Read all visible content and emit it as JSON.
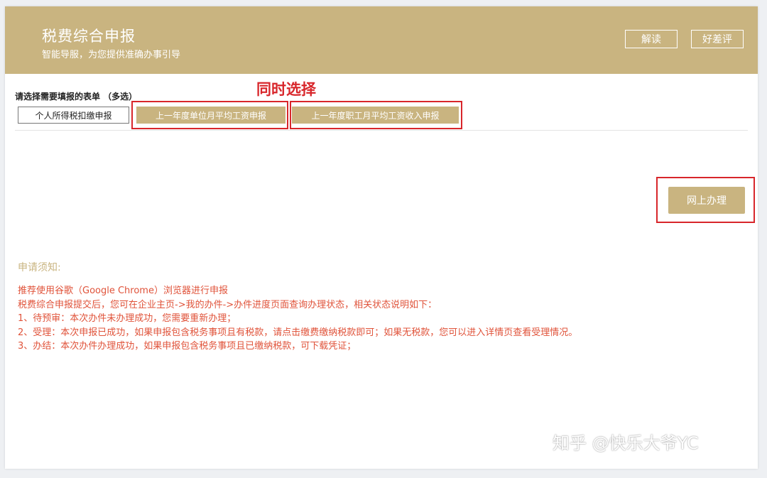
{
  "header": {
    "title": "税费综合申报",
    "subtitle": "智能导服，为您提供准确办事引导",
    "buttons": {
      "read": "解读",
      "rate": "好差评"
    }
  },
  "form": {
    "select_label": "请选择需要填报的表单 （多选）",
    "options": [
      {
        "label": "个人所得税扣缴申报",
        "selected": false
      },
      {
        "label": "上一年度单位月平均工资申报",
        "selected": true
      },
      {
        "label": "上一年度职工月平均工资收入申报",
        "selected": true
      }
    ]
  },
  "annotation": {
    "text": "同时选择"
  },
  "action": {
    "online_label": "网上办理"
  },
  "notice": {
    "title": "申请须知:",
    "lines": [
      "推荐使用谷歌（Google Chrome）浏览器进行申报",
      "税费综合申报提交后，您可在企业主页->我的办件->办件进度页面查询办理状态，相关状态说明如下：",
      "1、待预审：本次办件未办理成功，您需要重新办理；",
      "2、受理：本次申报已成功，如果申报包含税务事项且有税款，请点击缴费缴纳税款即可；如果无税款，您可以进入详情页查看受理情况。",
      "3、办结：本次办件办理成功，如果申报包含税务事项且已缴纳税款，可下载凭证；"
    ]
  },
  "watermark": "知乎 @快乐大爷YC",
  "colors": {
    "accent": "#c9b480",
    "annotation_red": "#d8262b",
    "notice_text": "#e0533a"
  }
}
